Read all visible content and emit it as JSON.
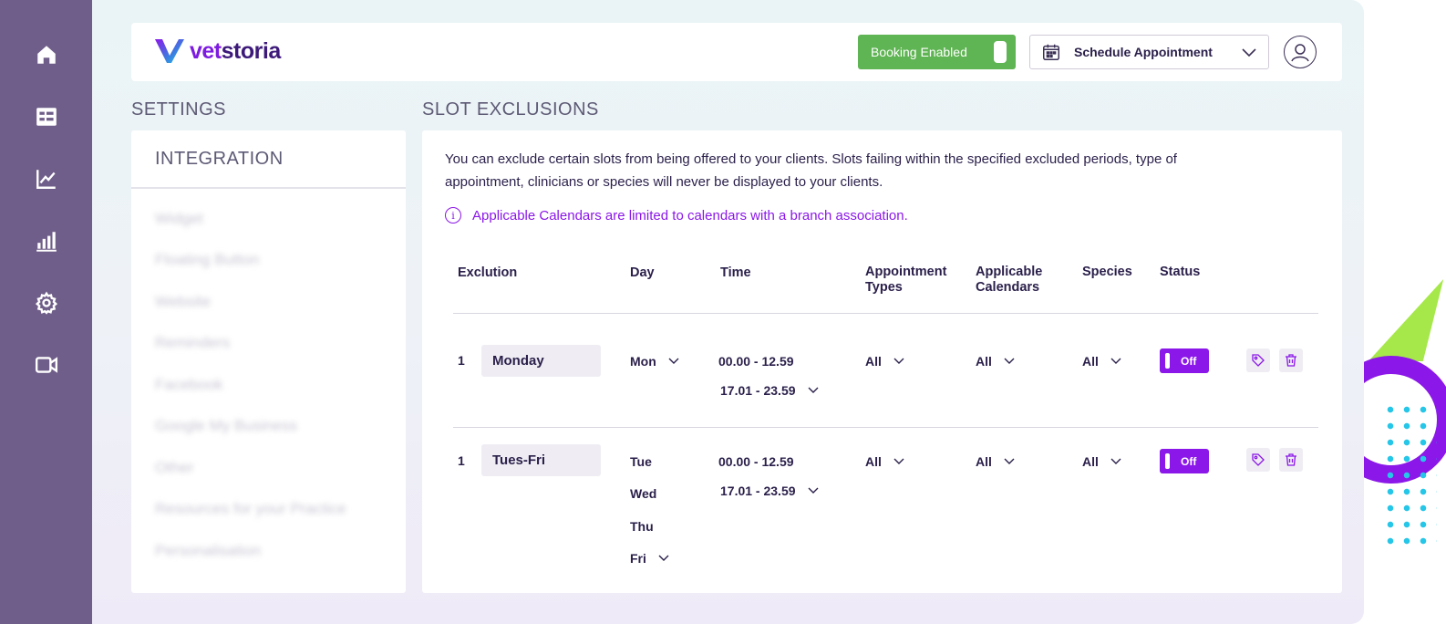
{
  "sidebar": {
    "items": [
      {
        "icon": "home-icon"
      },
      {
        "icon": "table-icon"
      },
      {
        "icon": "line-chart-icon"
      },
      {
        "icon": "bar-chart-icon"
      },
      {
        "icon": "gear-icon"
      },
      {
        "icon": "video-icon"
      }
    ]
  },
  "header": {
    "logo_prefix": "vet",
    "logo_suffix": "storia",
    "booking_label": "Booking Enabled",
    "schedule_label": "Schedule Appointment"
  },
  "settings": {
    "title": "SETTINGS",
    "tab": "INTEGRATION",
    "items": [
      "Widget",
      "Floating Button",
      "Website",
      "Reminders",
      "Facebook",
      "Google My Business",
      "Other",
      "Resources for your Practice",
      "Personalisation"
    ]
  },
  "slot_exclusions": {
    "title": "SLOT EXCLUSIONS",
    "intro": "You can exclude certain slots from being offered to your clients. Slots failing within the specified excluded periods, type of appointment, clinicians or species will never be displayed to your clients.",
    "note": "Applicable Calendars are limited to calendars with a branch association.",
    "columns": {
      "exclusion": "Exclution",
      "day": "Day",
      "time": "Time",
      "appointment_types": "Appointment Types",
      "applicable_calendars": "Applicable Calendars",
      "species": "Species",
      "status": "Status"
    },
    "rows": [
      {
        "index": "1",
        "name": "Monday",
        "days": [
          "Mon"
        ],
        "times": [
          "00.00 - 12.59",
          "17.01 - 23.59"
        ],
        "appointment_types": "All",
        "calendars": "All",
        "species": "All",
        "status": "Off"
      },
      {
        "index": "1",
        "name": "Tues-Fri",
        "days": [
          "Tue",
          "Wed",
          "Thu",
          "Fri"
        ],
        "times": [
          "00.00 - 12.59",
          "17.01 - 23.59"
        ],
        "appointment_types": "All",
        "calendars": "All",
        "species": "All",
        "status": "Off"
      }
    ]
  },
  "colors": {
    "sidebar": "#6f5e89",
    "accent": "#8b17e8",
    "booking_green": "#5fb453"
  }
}
